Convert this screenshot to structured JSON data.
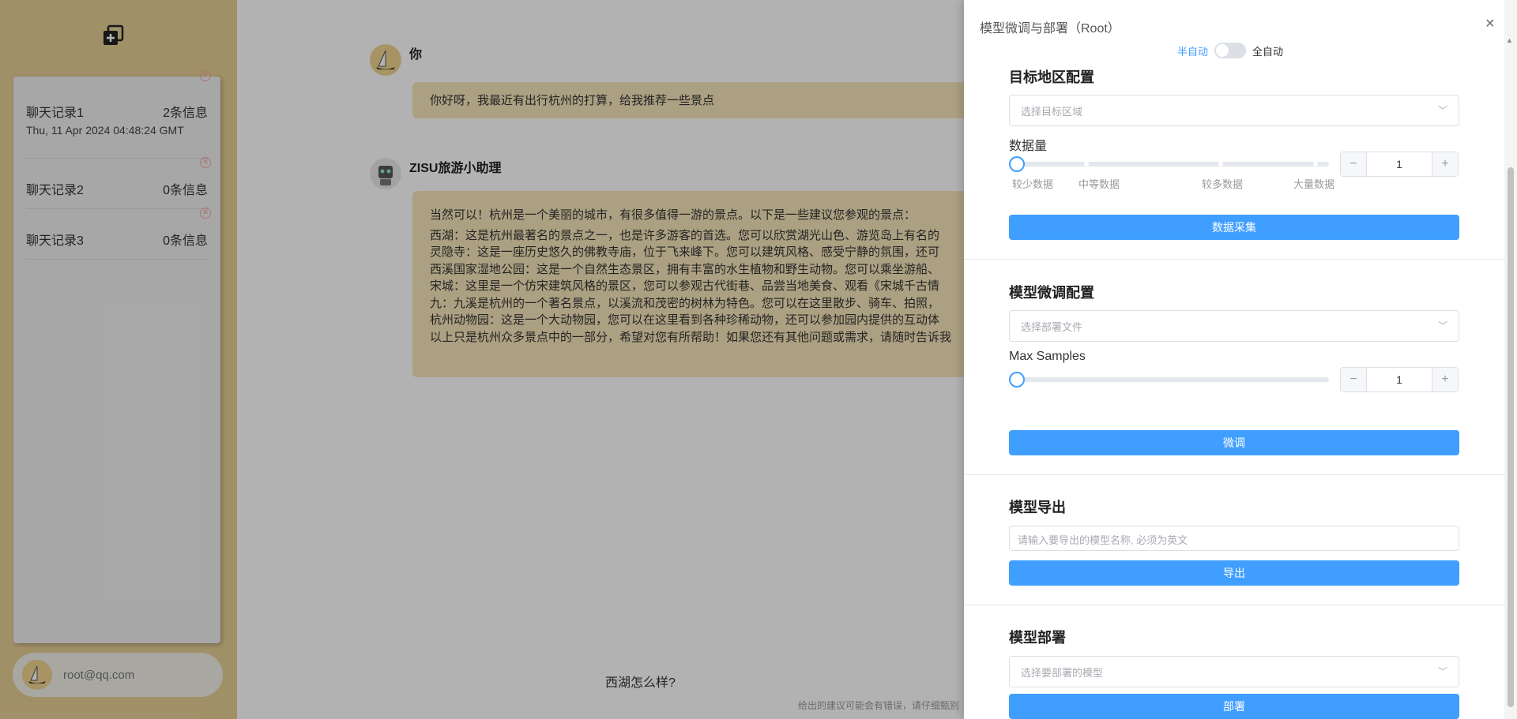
{
  "sidebar": {
    "new_chat_icon": "add-chat-icon",
    "history": [
      {
        "title": "聊天记录1",
        "count": "2条信息",
        "date": "Thu, 11 Apr 2024 04:48:24 GMT"
      },
      {
        "title": "聊天记录2",
        "count": "0条信息",
        "date": ""
      },
      {
        "title": "聊天记录3",
        "count": "0条信息",
        "date": ""
      }
    ],
    "user_email": "root@qq.com"
  },
  "chat": {
    "user_name": "你",
    "user_message": "你好呀，我最近有出行杭州的打算，给我推荐一些景点",
    "bot_name": "ZISU旅游小助理",
    "bot_lines": [
      "当然可以！杭州是一个美丽的城市，有很多值得一游的景点。以下是一些建议您参观的景点：",
      "西湖：这是杭州最著名的景点之一，也是许多游客的首选。您可以欣赏湖光山色、游览岛上有名的",
      "灵隐寺：这是一座历史悠久的佛教寺庙，位于飞来峰下。您可以建筑风格、感受宁静的氛围，还可",
      "西溪国家湿地公园：这是一个自然生态景区，拥有丰富的水生植物和野生动物。您可以乘坐游船、",
      "宋城：这里是一个仿宋建筑风格的景区，您可以参观古代街巷、品尝当地美食、观看《宋城千古情",
      "九：九溪是杭州的一个著名景点，以溪流和茂密的树林为特色。您可以在这里散步、骑车、拍照，",
      "杭州动物园：这是一个大动物园，您可以在这里看到各种珍稀动物，还可以参加园内提供的互动体",
      "以上只是杭州众多景点中的一部分，希望对您有所帮助！如果您还有其他问题或需求，请随时告诉我"
    ],
    "input_value": "西湖怎么样?",
    "disclaimer": "给出的建议可能会有错误，请仔细甄别"
  },
  "drawer": {
    "title": "模型微调与部署（Root）",
    "mode_semi": "半自动",
    "mode_full": "全自动",
    "mode_full_enabled": false,
    "region": {
      "title": "目标地区配置",
      "select_placeholder": "选择目标区域",
      "amount_label": "数据量",
      "marks": [
        "较少数据",
        "中等数据",
        "较多数据",
        "大量数据"
      ],
      "stepper_value": "1",
      "button": "数据采集"
    },
    "finetune": {
      "title": "模型微调配置",
      "select_placeholder": "选择部署文件",
      "samples_label": "Max Samples",
      "stepper_value": "1",
      "button": "微调"
    },
    "export": {
      "title": "模型导出",
      "input_placeholder": "请输入要导出的模型名称, 必须为英文",
      "button": "导出"
    },
    "deploy": {
      "title": "模型部署",
      "select_placeholder": "选择要部署的模型",
      "button": "部署"
    },
    "stepper_minus": "−",
    "stepper_plus": "+",
    "close_icon": "×"
  }
}
